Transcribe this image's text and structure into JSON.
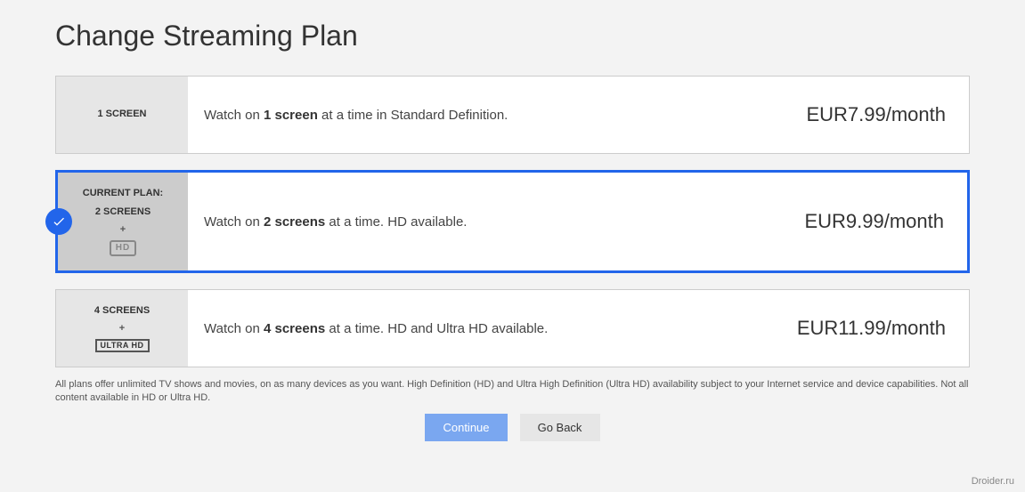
{
  "header": {
    "title": "Change Streaming Plan"
  },
  "plans": [
    {
      "label_screens": "1 SCREEN",
      "desc_pre": "Watch on ",
      "desc_bold": "1 screen",
      "desc_post": " at a time in Standard Definition.",
      "price": "EUR7.99/month"
    },
    {
      "current_label": "CURRENT PLAN:",
      "label_screens": "2 SCREENS",
      "plus": "+",
      "badge": "HD",
      "desc_pre": "Watch on ",
      "desc_bold": "2 screens",
      "desc_post": " at a time. HD available.",
      "price": "EUR9.99/month"
    },
    {
      "label_screens": "4 SCREENS",
      "plus": "+",
      "badge": "ULTRA HD",
      "desc_pre": "Watch on ",
      "desc_bold": "4 screens",
      "desc_post": " at a time. HD and Ultra HD available.",
      "price": "EUR11.99/month"
    }
  ],
  "disclaimer": "All plans offer unlimited TV shows and movies, on as many devices as you want. High Definition (HD) and Ultra High Definition (Ultra HD) availability subject to your Internet service and device capabilities. Not all content available in HD or Ultra HD.",
  "buttons": {
    "continue": "Continue",
    "goback": "Go Back"
  },
  "watermark": "Droider.ru"
}
